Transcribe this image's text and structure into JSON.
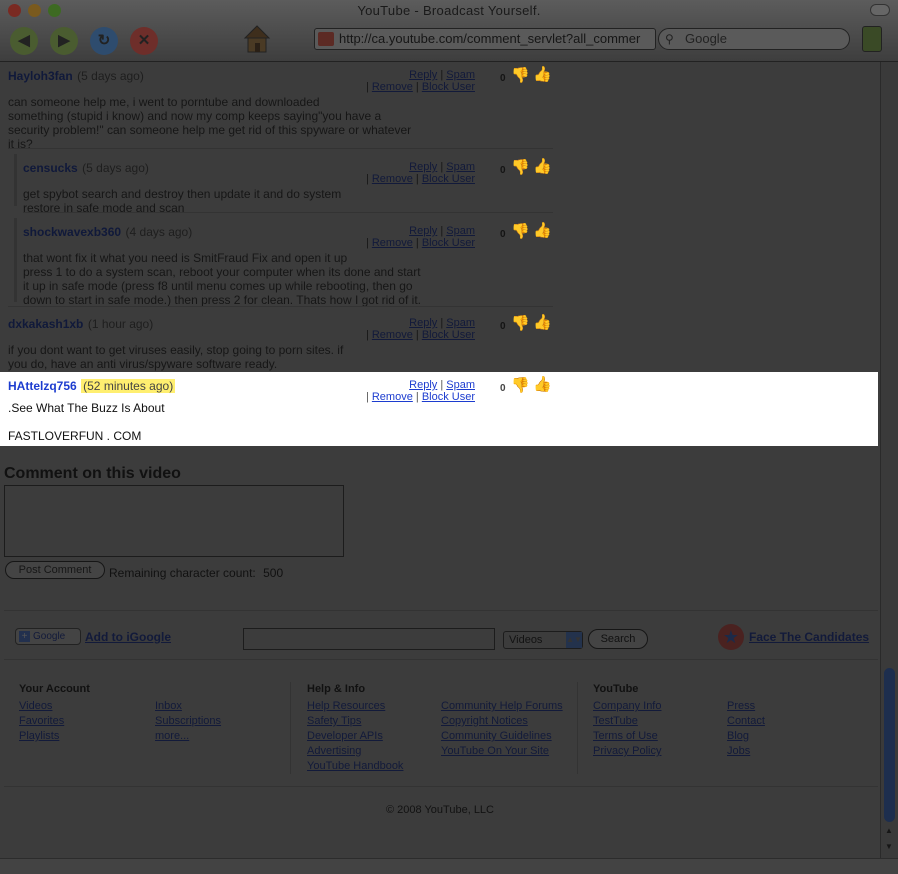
{
  "window": {
    "title": "YouTube - Broadcast Yourself."
  },
  "toolbar": {
    "url": "http://ca.youtube.com/comment_servlet?all_commer",
    "search_placeholder": "Google"
  },
  "comments": [
    {
      "user": "Hayloh3fan",
      "time": "(5 days ago)",
      "score": "0",
      "lines": [
        "can someone help me, i went to porntube and downloaded",
        "something (stupid i know) and now my comp keeps saying\"you have a",
        "security problem!\" can someone help me get rid of this spyware or whatever",
        "it is?"
      ]
    },
    {
      "user": "censucks",
      "time": "(5 days ago)",
      "score": "0",
      "lines": [
        "get spybot search and destroy then update it and do system",
        "restore in safe mode and scan"
      ]
    },
    {
      "user": "shockwavexb360",
      "time": "(4 days ago)",
      "score": "0",
      "lines": [
        "that wont fix it what you need is SmitFraud Fix and open it up",
        "press 1 to do a system scan, reboot your computer when its done and start",
        "it up in safe mode (press f8 until menu comes up while rebooting, then go",
        "down to start in safe mode.) then press 2 for clean. Thats how I got rid of it."
      ]
    },
    {
      "user": "dxkakash1xb",
      "time": "(1 hour ago)",
      "score": "0",
      "lines": [
        "if you dont want to get viruses easily, stop going to porn sites. if",
        "you do, have an anti virus/spyware software ready."
      ]
    },
    {
      "user": "HAttelzq756",
      "time": "(52 minutes ago)",
      "score": "0",
      "lines": [
        ".See What The Buzz Is About",
        "",
        "FASTLOVERFUN . COM"
      ]
    }
  ],
  "actions": {
    "reply": "Reply",
    "spam": "Spam",
    "remove": "Remove",
    "block": "Block User",
    "sep": "|"
  },
  "comment_form": {
    "heading": "Comment on this video",
    "post_label": "Post Comment",
    "remaining_label": "Remaining character count:",
    "remaining_count": "500"
  },
  "footer_bar": {
    "igoogle_logo": "Google",
    "add_igoogle": "Add to iGoogle",
    "select_value": "Videos",
    "search_label": "Search",
    "candidates": "Face The Candidates"
  },
  "footer": {
    "your_account": {
      "heading": "Your Account",
      "col1": [
        "Videos",
        "Favorites",
        "Playlists"
      ],
      "col2": [
        "Inbox",
        "Subscriptions",
        "more..."
      ]
    },
    "help": {
      "heading": "Help & Info",
      "col1": [
        "Help Resources",
        "Safety Tips",
        "Developer APIs",
        "Advertising",
        "YouTube Handbook"
      ],
      "col2": [
        "Community Help Forums",
        "Copyright Notices",
        "Community Guidelines",
        "YouTube On Your Site"
      ]
    },
    "youtube": {
      "heading": "YouTube",
      "col1": [
        "Company Info",
        "TestTube",
        "Terms of Use",
        "Privacy Policy"
      ],
      "col2": [
        "Press",
        "Contact",
        "Blog",
        "Jobs"
      ]
    },
    "copyright": "© 2008 YouTube, LLC"
  },
  "colors": {
    "highlight": "#ffef70",
    "link": "#1c3ccf",
    "overlay": "#3c3c3c"
  }
}
